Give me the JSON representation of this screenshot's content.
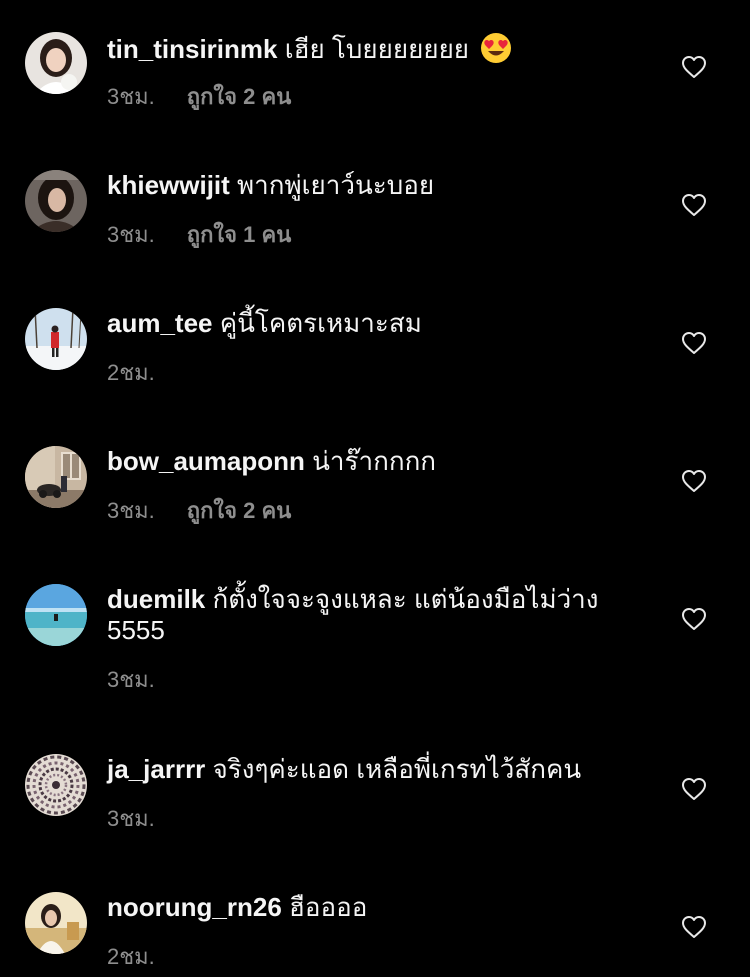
{
  "comments": [
    {
      "username": "tin_tinsirinmk",
      "text": "เฮีย โบยยยยยยย",
      "emoji": "heart-eyes-emoji",
      "time": "3ชม.",
      "likes": "ถูกใจ 2 คน"
    },
    {
      "username": "khiewwijit",
      "text": "พากพู่เยาว์นะบอย",
      "time": "3ชม.",
      "likes": "ถูกใจ 1 คน"
    },
    {
      "username": "aum_tee",
      "text": "คู่นี้โคตรเหมาะสม",
      "time": "2ชม."
    },
    {
      "username": "bow_aumaponn",
      "text": "น่าร๊ากกกก",
      "time": "3ชม.",
      "likes": "ถูกใจ 2 คน"
    },
    {
      "username": "duemilk",
      "text": "ก้ตั้งใจจะจูงแหละ แต่น้องมือไม่ว่าง 5555",
      "time": "3ชม."
    },
    {
      "username": "ja_jarrrr",
      "text": "จริงๆค่ะแอด เหลือพี่เกรทไว้สักคน",
      "time": "3ชม."
    },
    {
      "username": "noorung_rn26",
      "text": "ฮืออออ",
      "time": "2ชม."
    }
  ],
  "icons": {
    "like": "heart-outline-icon"
  },
  "colors": {
    "background": "#000000",
    "text": "#f5f5f5",
    "secondary": "#8e8e8e"
  }
}
